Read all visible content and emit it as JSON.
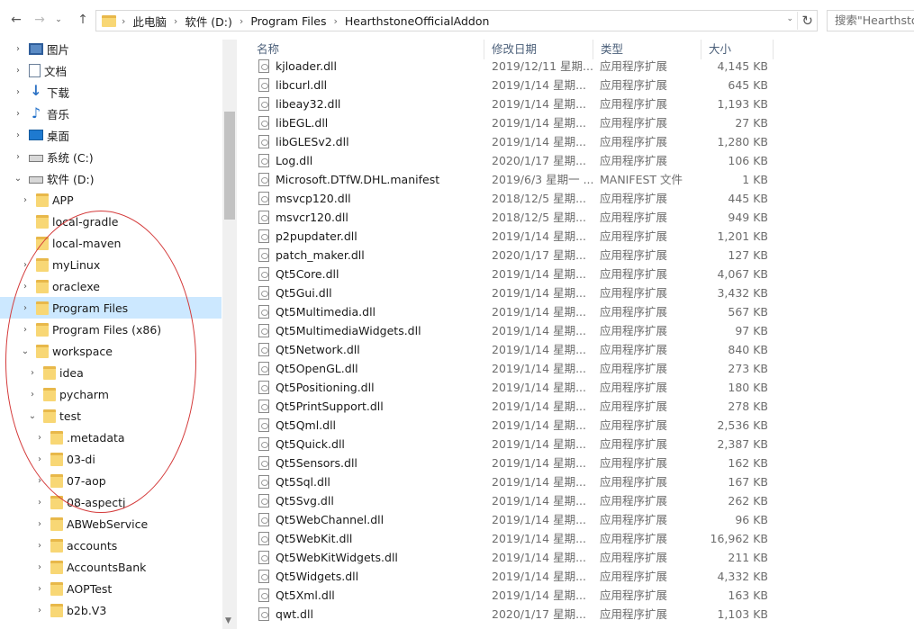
{
  "address": {
    "crumbs": [
      "此电脑",
      "软件 (D:)",
      "Program Files",
      "HearthstoneOfficialAddon"
    ],
    "search_placeholder": "搜索\"Hearthsto"
  },
  "nav": [
    {
      "label": "图片",
      "icon": "pictures",
      "chev": "›",
      "indent": 0
    },
    {
      "label": "文档",
      "icon": "docs",
      "chev": "›",
      "indent": 0
    },
    {
      "label": "下载",
      "icon": "download",
      "chev": "›",
      "indent": 0
    },
    {
      "label": "音乐",
      "icon": "music",
      "chev": "›",
      "indent": 0
    },
    {
      "label": "桌面",
      "icon": "desktop",
      "chev": "›",
      "indent": 0
    },
    {
      "label": "系统 (C:)",
      "icon": "drive",
      "chev": "›",
      "indent": 0
    },
    {
      "label": "软件 (D:)",
      "icon": "drive",
      "chev": "⌄",
      "indent": 0
    },
    {
      "label": "APP",
      "icon": "folder",
      "chev": "›",
      "indent": 1
    },
    {
      "label": "local-gradle",
      "icon": "folder",
      "chev": "",
      "indent": 1
    },
    {
      "label": "local-maven",
      "icon": "folder",
      "chev": "",
      "indent": 1
    },
    {
      "label": "myLinux",
      "icon": "folder",
      "chev": "›",
      "indent": 1
    },
    {
      "label": "oraclexe",
      "icon": "folder",
      "chev": "›",
      "indent": 1
    },
    {
      "label": "Program Files",
      "icon": "folder",
      "chev": "›",
      "indent": 1,
      "selected": true
    },
    {
      "label": "Program Files (x86)",
      "icon": "folder",
      "chev": "›",
      "indent": 1
    },
    {
      "label": "workspace",
      "icon": "folder",
      "chev": "⌄",
      "indent": 1
    },
    {
      "label": "idea",
      "icon": "folder",
      "chev": "›",
      "indent": 2
    },
    {
      "label": "pycharm",
      "icon": "folder",
      "chev": "›",
      "indent": 2
    },
    {
      "label": "test",
      "icon": "folder",
      "chev": "⌄",
      "indent": 2
    },
    {
      "label": ".metadata",
      "icon": "folder",
      "chev": "›",
      "indent": 3
    },
    {
      "label": "03-di",
      "icon": "folder",
      "chev": "›",
      "indent": 3
    },
    {
      "label": "07-aop",
      "icon": "folder",
      "chev": "›",
      "indent": 3
    },
    {
      "label": "08-aspectj",
      "icon": "folder",
      "chev": "›",
      "indent": 3
    },
    {
      "label": "ABWebService",
      "icon": "folder",
      "chev": "›",
      "indent": 3
    },
    {
      "label": "accounts",
      "icon": "folder",
      "chev": "›",
      "indent": 3
    },
    {
      "label": "AccountsBank",
      "icon": "folder",
      "chev": "›",
      "indent": 3
    },
    {
      "label": "AOPTest",
      "icon": "folder",
      "chev": "›",
      "indent": 3
    },
    {
      "label": "b2b.V3",
      "icon": "folder",
      "chev": "›",
      "indent": 3
    }
  ],
  "columns": {
    "name": "名称",
    "date": "修改日期",
    "type": "类型",
    "size": "大小"
  },
  "files": [
    {
      "name": "kjloader.dll",
      "date": "2019/12/11 星期...",
      "type": "应用程序扩展",
      "size": "4,145 KB"
    },
    {
      "name": "libcurl.dll",
      "date": "2019/1/14 星期...",
      "type": "应用程序扩展",
      "size": "645 KB"
    },
    {
      "name": "libeay32.dll",
      "date": "2019/1/14 星期...",
      "type": "应用程序扩展",
      "size": "1,193 KB"
    },
    {
      "name": "libEGL.dll",
      "date": "2019/1/14 星期...",
      "type": "应用程序扩展",
      "size": "27 KB"
    },
    {
      "name": "libGLESv2.dll",
      "date": "2019/1/14 星期...",
      "type": "应用程序扩展",
      "size": "1,280 KB"
    },
    {
      "name": "Log.dll",
      "date": "2020/1/17 星期...",
      "type": "应用程序扩展",
      "size": "106 KB"
    },
    {
      "name": "Microsoft.DTfW.DHL.manifest",
      "date": "2019/6/3 星期一 ...",
      "type": "MANIFEST 文件",
      "size": "1 KB"
    },
    {
      "name": "msvcp120.dll",
      "date": "2018/12/5 星期...",
      "type": "应用程序扩展",
      "size": "445 KB"
    },
    {
      "name": "msvcr120.dll",
      "date": "2018/12/5 星期...",
      "type": "应用程序扩展",
      "size": "949 KB"
    },
    {
      "name": "p2pupdater.dll",
      "date": "2019/1/14 星期...",
      "type": "应用程序扩展",
      "size": "1,201 KB"
    },
    {
      "name": "patch_maker.dll",
      "date": "2020/1/17 星期...",
      "type": "应用程序扩展",
      "size": "127 KB"
    },
    {
      "name": "Qt5Core.dll",
      "date": "2019/1/14 星期...",
      "type": "应用程序扩展",
      "size": "4,067 KB"
    },
    {
      "name": "Qt5Gui.dll",
      "date": "2019/1/14 星期...",
      "type": "应用程序扩展",
      "size": "3,432 KB"
    },
    {
      "name": "Qt5Multimedia.dll",
      "date": "2019/1/14 星期...",
      "type": "应用程序扩展",
      "size": "567 KB"
    },
    {
      "name": "Qt5MultimediaWidgets.dll",
      "date": "2019/1/14 星期...",
      "type": "应用程序扩展",
      "size": "97 KB"
    },
    {
      "name": "Qt5Network.dll",
      "date": "2019/1/14 星期...",
      "type": "应用程序扩展",
      "size": "840 KB"
    },
    {
      "name": "Qt5OpenGL.dll",
      "date": "2019/1/14 星期...",
      "type": "应用程序扩展",
      "size": "273 KB"
    },
    {
      "name": "Qt5Positioning.dll",
      "date": "2019/1/14 星期...",
      "type": "应用程序扩展",
      "size": "180 KB"
    },
    {
      "name": "Qt5PrintSupport.dll",
      "date": "2019/1/14 星期...",
      "type": "应用程序扩展",
      "size": "278 KB"
    },
    {
      "name": "Qt5Qml.dll",
      "date": "2019/1/14 星期...",
      "type": "应用程序扩展",
      "size": "2,536 KB"
    },
    {
      "name": "Qt5Quick.dll",
      "date": "2019/1/14 星期...",
      "type": "应用程序扩展",
      "size": "2,387 KB"
    },
    {
      "name": "Qt5Sensors.dll",
      "date": "2019/1/14 星期...",
      "type": "应用程序扩展",
      "size": "162 KB"
    },
    {
      "name": "Qt5Sql.dll",
      "date": "2019/1/14 星期...",
      "type": "应用程序扩展",
      "size": "167 KB"
    },
    {
      "name": "Qt5Svg.dll",
      "date": "2019/1/14 星期...",
      "type": "应用程序扩展",
      "size": "262 KB"
    },
    {
      "name": "Qt5WebChannel.dll",
      "date": "2019/1/14 星期...",
      "type": "应用程序扩展",
      "size": "96 KB"
    },
    {
      "name": "Qt5WebKit.dll",
      "date": "2019/1/14 星期...",
      "type": "应用程序扩展",
      "size": "16,962 KB"
    },
    {
      "name": "Qt5WebKitWidgets.dll",
      "date": "2019/1/14 星期...",
      "type": "应用程序扩展",
      "size": "211 KB"
    },
    {
      "name": "Qt5Widgets.dll",
      "date": "2019/1/14 星期...",
      "type": "应用程序扩展",
      "size": "4,332 KB"
    },
    {
      "name": "Qt5Xml.dll",
      "date": "2019/1/14 星期...",
      "type": "应用程序扩展",
      "size": "163 KB"
    },
    {
      "name": "qwt.dll",
      "date": "2020/1/17 星期...",
      "type": "应用程序扩展",
      "size": "1,103 KB"
    }
  ],
  "colors": {
    "selection": "#cce8ff",
    "annotation": "#d43a3a",
    "folder": "#f8d775"
  }
}
